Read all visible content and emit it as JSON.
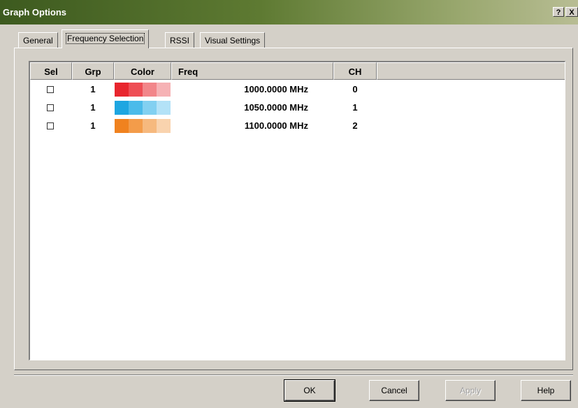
{
  "window": {
    "title": "Graph Options",
    "help_label": "?",
    "close_label": "X"
  },
  "tabs": [
    {
      "label": "General",
      "active": false
    },
    {
      "label": "Frequency Selection",
      "active": true
    },
    {
      "label": "RSSI",
      "active": false
    },
    {
      "label": "Visual Settings",
      "active": false
    }
  ],
  "list": {
    "columns": {
      "sel": "Sel",
      "grp": "Grp",
      "color": "Color",
      "freq": "Freq",
      "ch": "CH"
    },
    "rows": [
      {
        "checked": false,
        "grp": "1",
        "colors": [
          "#e8262e",
          "#ee4e55",
          "#f2868a",
          "#f6b2b5"
        ],
        "freq": "1000.0000 MHz",
        "ch": "0"
      },
      {
        "checked": false,
        "grp": "1",
        "colors": [
          "#1ea6e1",
          "#4bbbea",
          "#82d0f1",
          "#b3e2f7"
        ],
        "freq": "1050.0000 MHz",
        "ch": "1"
      },
      {
        "checked": false,
        "grp": "1",
        "colors": [
          "#f0821f",
          "#f39c4a",
          "#f6b97e",
          "#f9d3ae"
        ],
        "freq": "1100.0000 MHz",
        "ch": "2"
      }
    ]
  },
  "buttons": {
    "ok": "OK",
    "cancel": "Cancel",
    "apply": "Apply",
    "help": "Help"
  }
}
